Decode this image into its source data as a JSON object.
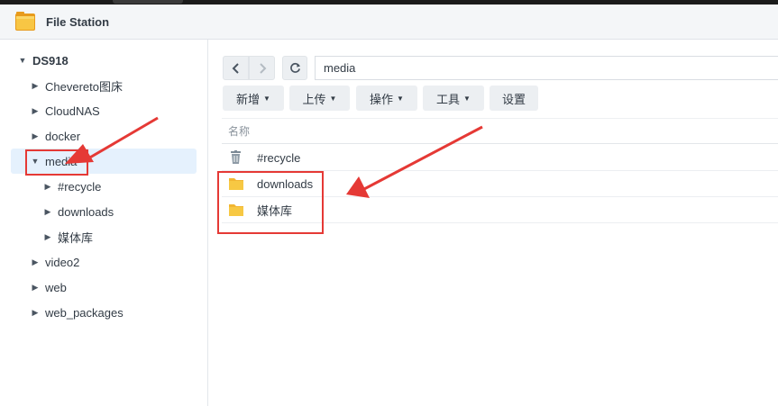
{
  "app": {
    "title": "File Station"
  },
  "tree": {
    "root": "DS918",
    "items": [
      {
        "label": "Chevereto图床"
      },
      {
        "label": "CloudNAS"
      },
      {
        "label": "docker"
      },
      {
        "label": "media"
      },
      {
        "label": "#recycle"
      },
      {
        "label": "downloads"
      },
      {
        "label": "媒体库"
      },
      {
        "label": "video2"
      },
      {
        "label": "web"
      },
      {
        "label": "web_packages"
      }
    ]
  },
  "path": {
    "value": "media"
  },
  "toolbar": {
    "create": "新增",
    "upload": "上传",
    "action": "操作",
    "tools": "工具",
    "settings": "设置"
  },
  "list": {
    "column_name": "名称",
    "rows": [
      {
        "name": "#recycle",
        "icon": "recycle-bin-icon"
      },
      {
        "name": "downloads",
        "icon": "folder-icon"
      },
      {
        "name": "媒体库",
        "icon": "folder-icon"
      }
    ]
  },
  "colors": {
    "accent_selected": "#e5f1fd",
    "folder": "#f7c843",
    "annotation": "#e53935"
  }
}
